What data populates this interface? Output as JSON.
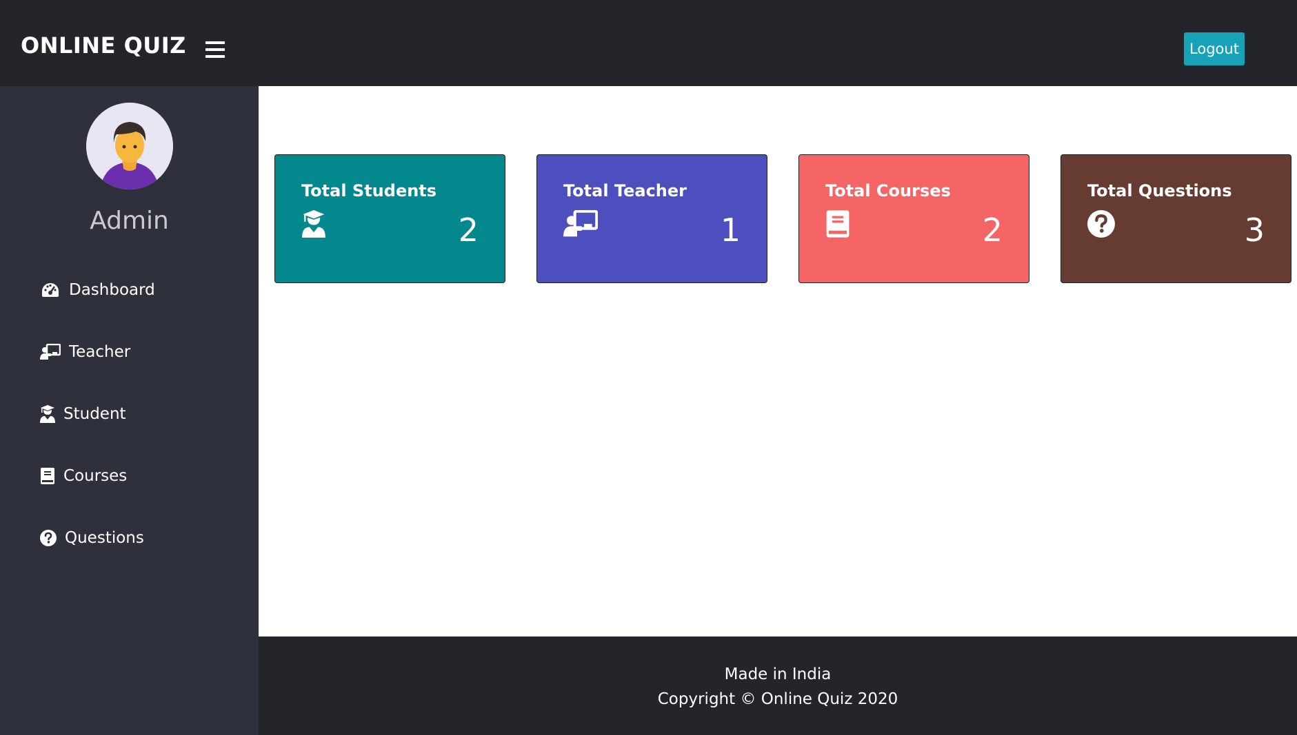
{
  "header": {
    "brand": "ONLINE QUIZ",
    "menu_icon": "hamburger-menu-icon",
    "logout_label": "Logout"
  },
  "sidebar": {
    "avatar_icon": "user-avatar",
    "username": "Admin",
    "items": [
      {
        "label": "Dashboard",
        "icon": "tachometer-icon"
      },
      {
        "label": "Teacher",
        "icon": "chalkboard-teacher-icon"
      },
      {
        "label": "Student",
        "icon": "user-graduate-icon"
      },
      {
        "label": "Courses",
        "icon": "book-icon"
      },
      {
        "label": "Questions",
        "icon": "question-circle-icon"
      }
    ]
  },
  "cards": [
    {
      "title": "Total Students",
      "value": "2",
      "icon": "user-graduate-icon",
      "color": "#03888d"
    },
    {
      "title": "Total Teacher",
      "value": "1",
      "icon": "chalkboard-teacher-icon",
      "color": "#4d4fbf"
    },
    {
      "title": "Total Courses",
      "value": "2",
      "icon": "book-icon",
      "color": "#f56566"
    },
    {
      "title": "Total Questions",
      "value": "3",
      "icon": "question-circle-icon",
      "color": "#653b32"
    }
  ],
  "footer": {
    "line1": "Made in India",
    "line2": "Copyright © Online Quiz 2020"
  },
  "colors": {
    "topbar": "#23252b",
    "sidebar": "#2e313b",
    "accent": "#17a2b8"
  }
}
